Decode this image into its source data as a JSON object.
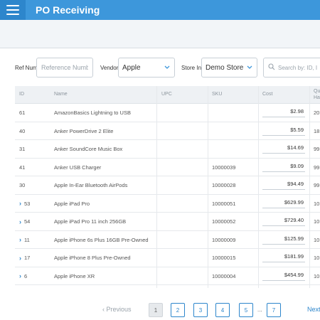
{
  "app": {
    "title": "PO Receiving"
  },
  "filters": {
    "ref_label": "Ref Num",
    "ref_placeholder": "Reference Number",
    "ref_value": "",
    "vendor_label": "Vendor",
    "vendor_value": "Apple",
    "store_label": "Store In",
    "store_value": "Demo Store",
    "search_placeholder": "Search by: ID, I"
  },
  "table": {
    "headers": {
      "id": "ID",
      "name": "Name",
      "upc": "UPC",
      "sku": "SKU",
      "cost": "Cost",
      "qty": "Qu Ha"
    },
    "rows": [
      {
        "id": "61",
        "expandable": false,
        "name": "AmazonBasics Lightning to USB",
        "upc": "",
        "sku": "",
        "cost": "$2.98",
        "qty": "20"
      },
      {
        "id": "40",
        "expandable": false,
        "name": "Anker PowerDrive 2 Elite",
        "upc": "",
        "sku": "",
        "cost": "$5.59",
        "qty": "18"
      },
      {
        "id": "31",
        "expandable": false,
        "name": "Anker SoundCore Music Box",
        "upc": "",
        "sku": "",
        "cost": "$14.69",
        "qty": "99"
      },
      {
        "id": "41",
        "expandable": false,
        "name": "Anker USB Charger",
        "upc": "",
        "sku": "10000039",
        "cost": "$9.09",
        "qty": "99"
      },
      {
        "id": "30",
        "expandable": false,
        "name": "Apple In-Ear Bluetooth AirPods",
        "upc": "",
        "sku": "10000028",
        "cost": "$94.49",
        "qty": "99"
      },
      {
        "id": "53",
        "expandable": true,
        "name": "Apple iPad Pro",
        "upc": "",
        "sku": "10000051",
        "cost": "$629.99",
        "qty": "10"
      },
      {
        "id": "54",
        "expandable": true,
        "name": "Apple iPad Pro 11 inch 256GB",
        "upc": "",
        "sku": "10000052",
        "cost": "$729.40",
        "qty": "10"
      },
      {
        "id": "11",
        "expandable": true,
        "name": "Apple iPhone 6s Plus 16GB Pre-Owned",
        "upc": "",
        "sku": "10000009",
        "cost": "$125.99",
        "qty": "10"
      },
      {
        "id": "17",
        "expandable": true,
        "name": "Apple iPhone 8 Plus Pre-Owned",
        "upc": "",
        "sku": "10000015",
        "cost": "$181.99",
        "qty": "10"
      },
      {
        "id": "6",
        "expandable": true,
        "name": "Apple iPhone XR",
        "upc": "",
        "sku": "10000004",
        "cost": "$454.99",
        "qty": "10"
      }
    ]
  },
  "pagination": {
    "prev": "‹ Previous",
    "next": "Next",
    "pages": [
      "1",
      "2",
      "3",
      "4",
      "5",
      "7"
    ],
    "ellipsis": "...",
    "active": "1"
  },
  "colors": {
    "accent": "#3d97db",
    "accent_dark": "#2d86cc"
  }
}
